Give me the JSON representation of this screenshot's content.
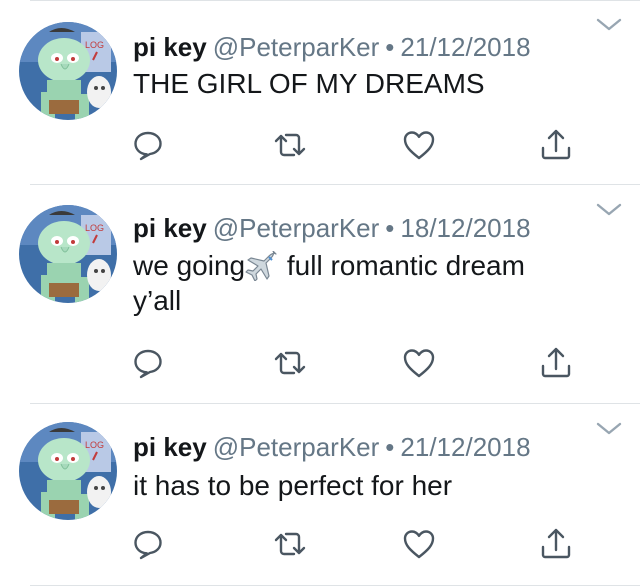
{
  "colors": {
    "text": "#14171a",
    "muted": "#657786",
    "divider": "#dfe3e6",
    "icon": "#4a5661"
  },
  "tweets": [
    {
      "name": "pi key",
      "handle": "@PeterparKer",
      "separator": "•",
      "date": "21/12/2018",
      "text": "THE GIRL OF MY DREAMS"
    },
    {
      "name": "pi key",
      "handle": "@PeterparKer",
      "separator": "•",
      "date": "18/12/2018",
      "text_before": "we going",
      "text_after": " full romantic dream",
      "text_line2": "y’all",
      "emoji": "airplane-emoji"
    },
    {
      "name": "pi key",
      "handle": "@PeterparKer",
      "separator": "•",
      "date": "21/12/2018",
      "text": "it has to be perfect for her"
    }
  ],
  "icons": {
    "reply": "reply-icon",
    "retweet": "retweet-icon",
    "like": "like-icon",
    "share": "share-icon",
    "more": "chevron-down-icon"
  }
}
